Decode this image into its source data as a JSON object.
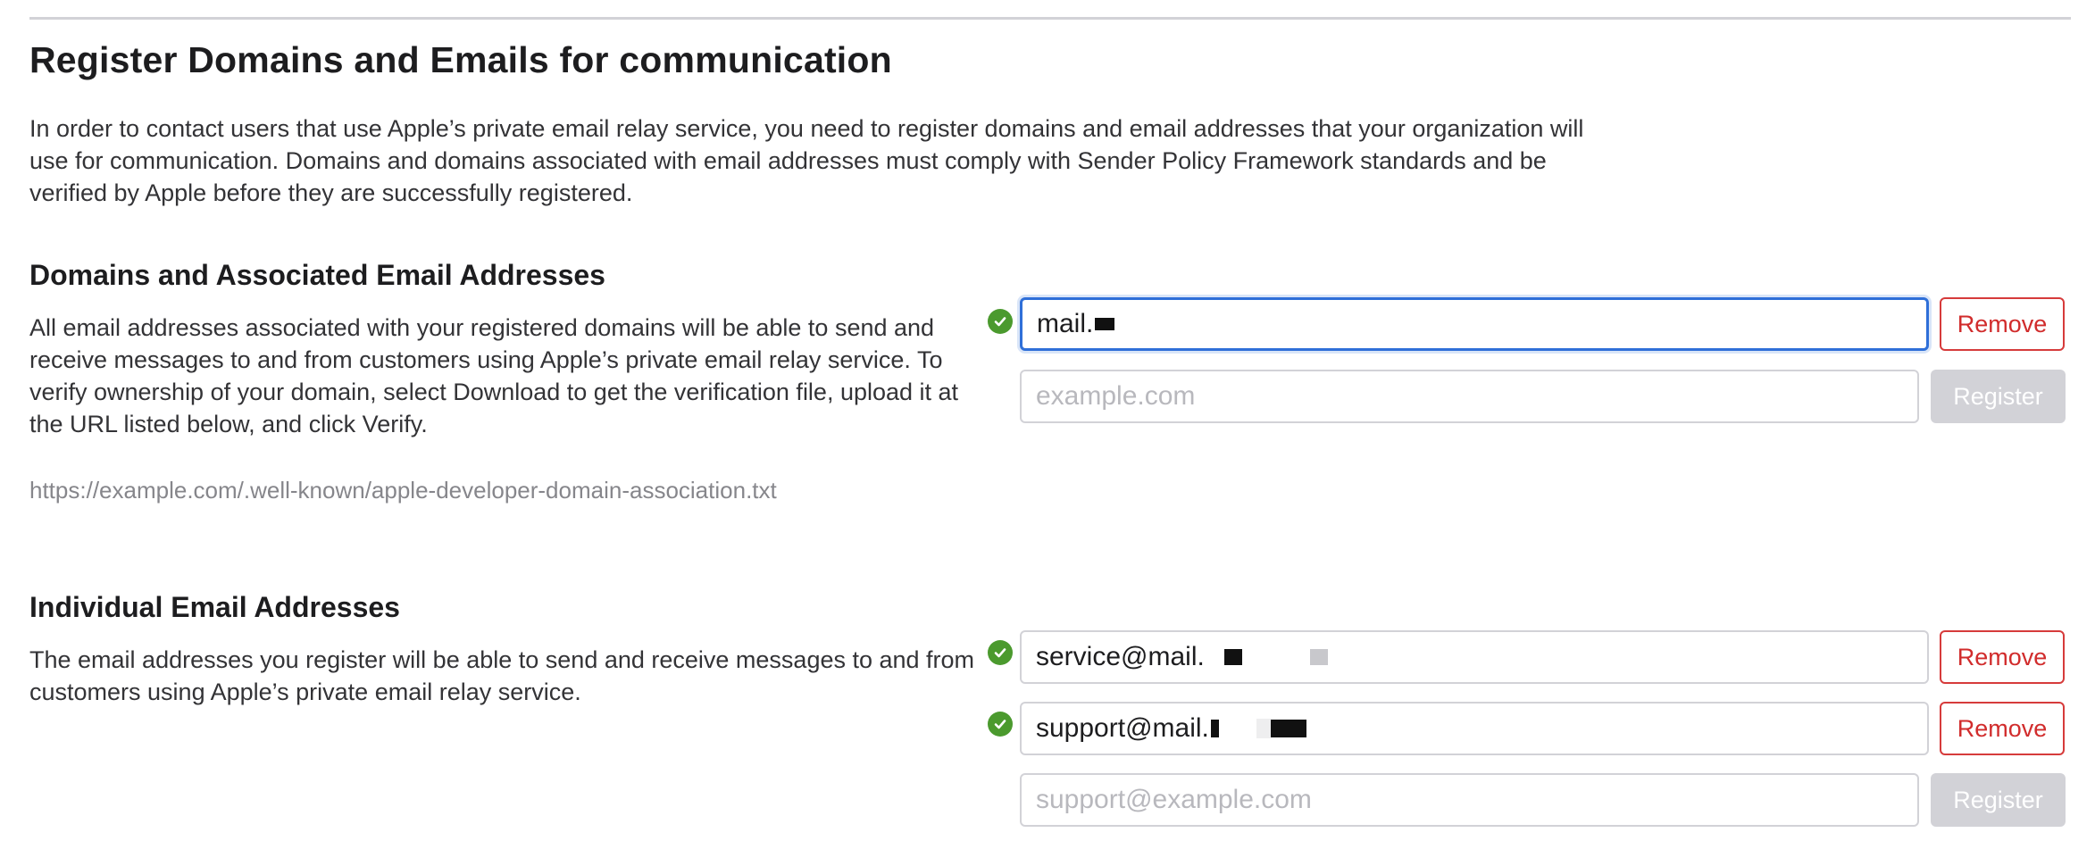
{
  "page": {
    "title": "Register Domains and Emails for communication",
    "intro": "In order to contact users that use Apple’s private email relay service, you need to register domains and email addresses that your organization will use for communication. Domains and domains associated with email addresses must comply with Sender Policy Framework standards and be verified by Apple before they are successfully registered."
  },
  "domains": {
    "title": "Domains and Associated Email Addresses",
    "description": "All email addresses associated with your registered domains will be able to send and receive messages to and from customers using Apple’s private email relay service. To verify ownership of your domain, select Download to get the verification file, upload it at the URL listed below, and click Verify.",
    "url_hint": "https://example.com/.well-known/apple-developer-domain-association.txt",
    "entries": [
      {
        "value": "mail.",
        "status": "verified",
        "action": "Remove"
      }
    ],
    "new_placeholder": "example.com",
    "register_label": "Register"
  },
  "emails": {
    "title": "Individual Email Addresses",
    "description": "The email addresses you register will be able to send and receive messages to and from customers using Apple’s private email relay service.",
    "entries": [
      {
        "value": "service@mail.",
        "status": "verified",
        "action": "Remove"
      },
      {
        "value": "support@mail.",
        "status": "verified",
        "action": "Remove"
      }
    ],
    "new_placeholder": "support@example.com",
    "register_label": "Register"
  },
  "colors": {
    "check_green": "#4b9a2e",
    "remove_red": "#d12c2c",
    "focus_blue": "#2f6fd8",
    "disabled_gray": "#d2d2d7"
  },
  "icons": {
    "verified": "checkmark-circle-icon"
  }
}
